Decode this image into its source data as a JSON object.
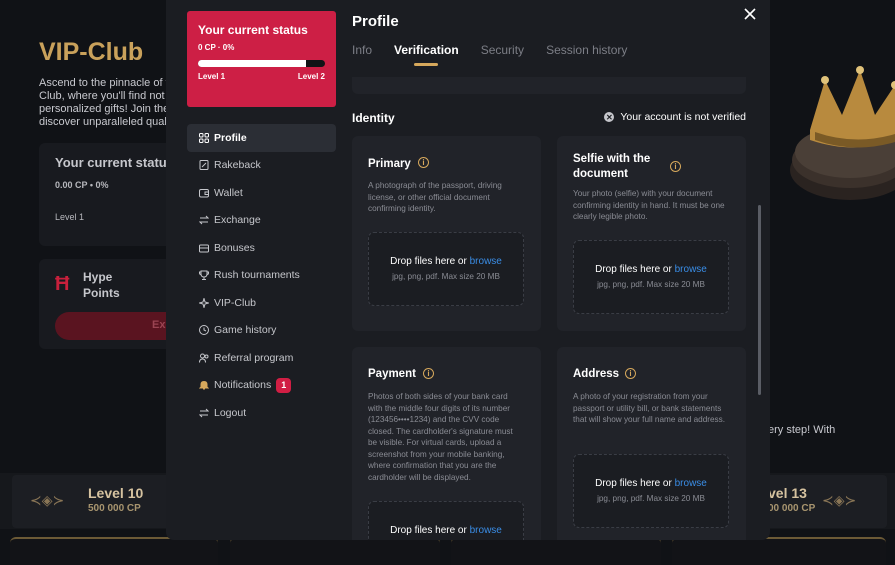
{
  "background": {
    "title": "VIP-Club",
    "description": "Ascend to the pinnacle of th\nClub, where you'll find not ju\npersonalized gifts! Join the c\ndiscover unparalleled qualit",
    "status_card": {
      "title": "Your current status",
      "cp": "0.00 CP • 0%",
      "level": "Level 1"
    },
    "hype": {
      "name": "Hype Points",
      "button": "Ex"
    },
    "right_text": "ery step! With",
    "levels": [
      {
        "name": "Level 10",
        "cp": "500 000 CP"
      },
      {
        "name": "vel 13",
        "cp": "00 000 CP"
      }
    ]
  },
  "status_card": {
    "title": "Your current status",
    "cp": "0 CP · 0%",
    "progress": 0.85,
    "level_from": "Level 1",
    "level_to": "Level 2"
  },
  "nav": {
    "items": [
      {
        "label": "Profile",
        "icon": "grid-icon",
        "active": true
      },
      {
        "label": "Rakeback",
        "icon": "rakeback-icon"
      },
      {
        "label": "Wallet",
        "icon": "wallet-icon"
      },
      {
        "label": "Exchange",
        "icon": "exchange-icon"
      },
      {
        "label": "Bonuses",
        "icon": "gift-icon"
      },
      {
        "label": "Rush tournaments",
        "icon": "trophy-icon"
      },
      {
        "label": "VIP-Club",
        "icon": "sparkle-icon"
      },
      {
        "label": "Game history",
        "icon": "clock-icon"
      },
      {
        "label": "Referral program",
        "icon": "users-icon"
      },
      {
        "label": "Notifications",
        "icon": "bell-icon",
        "badge": "1"
      },
      {
        "label": "Logout",
        "icon": "logout-icon"
      }
    ]
  },
  "profile": {
    "title": "Profile",
    "tabs": [
      "Info",
      "Verification",
      "Security",
      "Session history"
    ],
    "active_tab": "Verification",
    "identity_heading": "Identity",
    "verification_status": "Your account is not verified",
    "documents": {
      "primary": {
        "title": "Primary",
        "description": "A photograph of the passport, driving license, or other official document confirming identity."
      },
      "selfie": {
        "title": "Selfie with the document",
        "description": "Your photo (selfie) with your document confirming identity in hand. It must be one clearly legible photo."
      },
      "payment": {
        "title": "Payment",
        "description": "Photos of both sides of your bank card with the middle four digits of its number (123456••••1234) and the CVV code closed. The cardholder's signature must be visible. For virtual cards, upload a screenshot from your mobile banking, where confirmation that you are the cardholder will be displayed."
      },
      "address": {
        "title": "Address",
        "description": "A photo of your registration from your passport or utility bill, or bank statements that will show your full name and address."
      }
    },
    "dropzone": {
      "prompt": "Drop files here or",
      "browse": "browse",
      "hint": "jpg, png, pdf. Max size 20 MB"
    }
  },
  "colors": {
    "accent_red": "#cd1f45",
    "gold": "#d6a85c",
    "link_blue": "#3a8de6",
    "modal_bg": "#1b1d22",
    "card_bg": "#212329"
  }
}
